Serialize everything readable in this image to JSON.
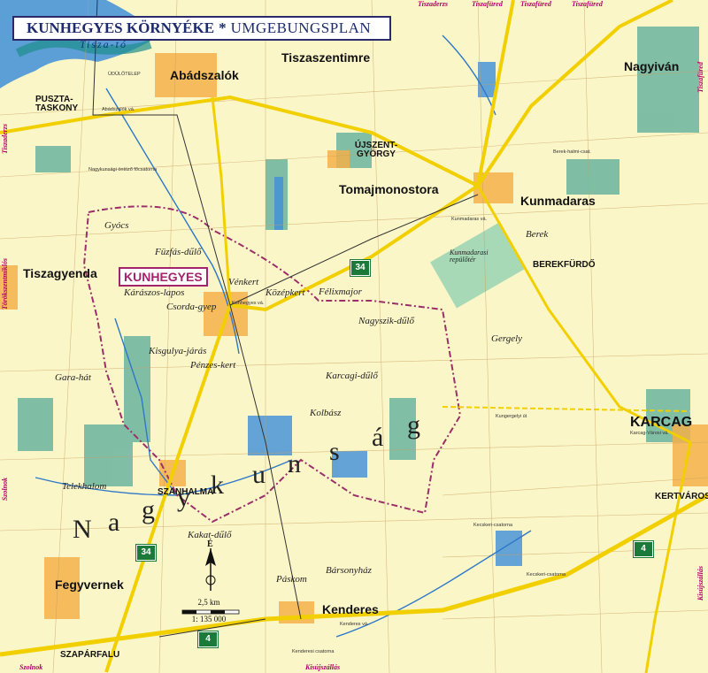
{
  "title": {
    "main": "KUNHEGYES KÖRNYÉKE",
    "separator": "*",
    "sub": "UMGEBUNGSPLAN"
  },
  "colors": {
    "background": "#fbf6c8",
    "water": "#2f78c8",
    "forest": "#1c8f8a",
    "town": "#f3b04a",
    "border": "#9b2f6a",
    "road": "#ffd400",
    "highway_shield": "#1b7a3a"
  },
  "towns": {
    "kunhegyes": "KUNHEGYES",
    "karcag": "KARCAG",
    "abadszalok": "Abádszalók",
    "tiszaszentimre": "Tiszaszentimre",
    "nagyivan": "Nagyiván",
    "tomajmonostora": "Tomajmonostora",
    "kunmadaras": "Kunmadaras",
    "tiszagyenda": "Tiszagyenda",
    "fegyvernek": "Fegyvernek",
    "kenderes": "Kenderes",
    "ujszentgyorgy": "ÚJSZENT-GYÖRGY",
    "pusztataskony": "PUSZTA-TASKONY",
    "szaparfalu": "SZAPÁRFALU",
    "kertvaros": "KERTVÁROS",
    "szanhalma": "SZANHALMA",
    "berekfurdo": "BEREKFÜRDŐ"
  },
  "areas": [
    "Gyócs",
    "Füzfás-dűlő",
    "Kárászos-lapos",
    "Csorda-gyep",
    "Kisgulya-járás",
    "Pénzes-kert",
    "Vénkert",
    "Középkert",
    "Félixmajor",
    "Nagyszik-dűlő",
    "Karcagi-dűlő",
    "Kolbász",
    "Gergely",
    "Berek",
    "Gara-hát",
    "Telekhalom",
    "Kakat-dűlő",
    "Páskom",
    "Bársonyház",
    "Kunmadarasi repülőtér"
  ],
  "big_label": [
    "N",
    "a",
    "g",
    "y",
    "k",
    "u",
    "n",
    "s",
    "á",
    "g"
  ],
  "lake": "Tisza-tó",
  "edge_labels": {
    "top": [
      "Tiszaderzs",
      "Tiszafüred",
      "Tiszafüred",
      "Tiszafüred"
    ],
    "bottom": [
      "Szolnok",
      "Kisújszállás"
    ],
    "left": [
      "Tiszaderzs",
      "Törökszentmiklós",
      "Szolnok"
    ],
    "right": [
      "Tiszafüred",
      "Kisújszállás"
    ]
  },
  "roads": {
    "r34_a": "34",
    "r34_b": "34",
    "r4_a": "4",
    "r4_b": "4"
  },
  "small_labels": [
    "ÜDÜLŐTELEP",
    "Abádszalók vá.",
    "Kunhegyes vá.",
    "Kenderes vá.",
    "Kunmadaras vá.",
    "Kungergelyi út",
    "Karcag-Városi vá.",
    "Kecskeri-csatorna",
    "Kecskeri-csatorna",
    "Berek-halmi-csat.",
    "Nagykunsági öntöző főcsatorna",
    "Kenderesi csatorna"
  ],
  "scale": {
    "north": "É",
    "distance": "2,5 km",
    "ratio": "1: 135 000"
  }
}
